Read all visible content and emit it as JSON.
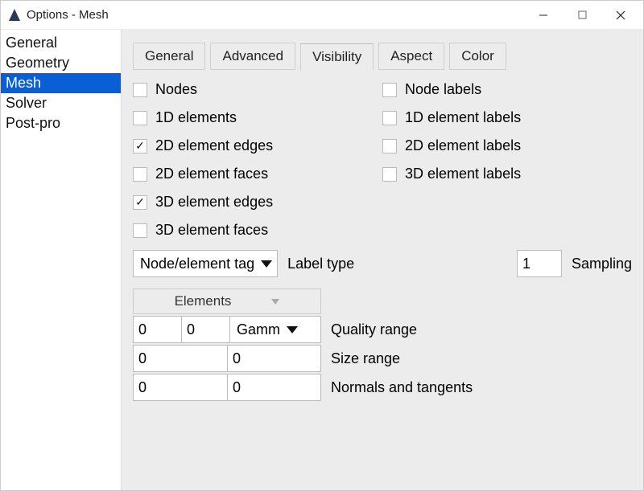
{
  "window": {
    "title": "Options - Mesh"
  },
  "sidebar": {
    "items": [
      {
        "label": "General",
        "selected": false
      },
      {
        "label": "Geometry",
        "selected": false
      },
      {
        "label": "Mesh",
        "selected": true
      },
      {
        "label": "Solver",
        "selected": false
      },
      {
        "label": "Post-pro",
        "selected": false
      }
    ]
  },
  "tabs": {
    "items": [
      {
        "label": "General",
        "active": false
      },
      {
        "label": "Advanced",
        "active": false
      },
      {
        "label": "Visibility",
        "active": true
      },
      {
        "label": "Aspect",
        "active": false
      },
      {
        "label": "Color",
        "active": false
      }
    ]
  },
  "checks": {
    "col1": [
      {
        "label": "Nodes",
        "checked": false
      },
      {
        "label": "1D elements",
        "checked": false
      },
      {
        "label": "2D element edges",
        "checked": true
      },
      {
        "label": "2D element faces",
        "checked": false
      },
      {
        "label": "3D element edges",
        "checked": true
      },
      {
        "label": "3D element faces",
        "checked": false
      }
    ],
    "col2": [
      {
        "label": "Node labels",
        "checked": false
      },
      {
        "label": "1D element labels",
        "checked": false
      },
      {
        "label": "2D element labels",
        "checked": false
      },
      {
        "label": "3D element labels",
        "checked": false
      }
    ]
  },
  "labeltype": {
    "select": "Node/element tag",
    "label": "Label type"
  },
  "sampling": {
    "value": "1",
    "label": "Sampling"
  },
  "elements_header": "Elements",
  "rows": {
    "quality": {
      "a": "0",
      "b": "0",
      "c": "Gamm",
      "label": "Quality range"
    },
    "size": {
      "a": "0",
      "b": "0",
      "label": "Size range"
    },
    "normals": {
      "a": "0",
      "b": "0",
      "label": "Normals and tangents"
    }
  }
}
